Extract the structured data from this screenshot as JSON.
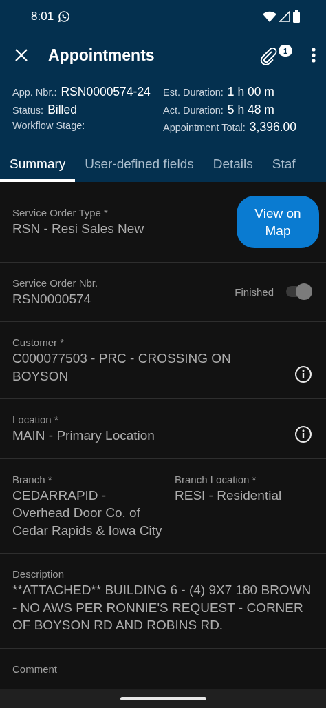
{
  "status_bar": {
    "time": "8:01"
  },
  "app_bar": {
    "title": "Appointments",
    "attachment_count": "1"
  },
  "summary": {
    "left": [
      {
        "label": "App. Nbr.:",
        "value": "RSN0000574-24"
      },
      {
        "label": "Status:",
        "value": "Billed"
      },
      {
        "label": "Workflow Stage:"
      }
    ],
    "right": [
      {
        "label": "Est. Duration:",
        "value": "1 h 00 m"
      },
      {
        "label": "Act. Duration:",
        "value": "5 h 48 m"
      },
      {
        "label": "Appointment Total:",
        "value": "3,396.00"
      }
    ]
  },
  "tabs": [
    {
      "label": "Summary",
      "selected": true
    },
    {
      "label": "User-defined fields",
      "selected": false
    },
    {
      "label": "Details",
      "selected": false
    },
    {
      "label": "Staf",
      "selected": false
    }
  ],
  "form": [
    {
      "kind": "button",
      "fields": [
        {
          "label": "Service Order Type *",
          "value": "RSN - Resi Sales New"
        }
      ],
      "button": "View on Map"
    },
    {
      "kind": "toggle",
      "fields": [
        {
          "label": "Service Order Nbr.",
          "value": "RSN0000574"
        }
      ],
      "toggle": {
        "label": "Finished",
        "checked": true,
        "disabled": true
      }
    },
    {
      "kind": "info",
      "fields": [
        {
          "label": "Customer *",
          "value": "C000077503 - PRC - CROSSING ON BOYSON"
        }
      ]
    },
    {
      "kind": "info",
      "fields": [
        {
          "label": "Location *",
          "value": "MAIN - Primary Location"
        }
      ]
    },
    {
      "kind": "plain",
      "fields": [
        {
          "label": "Branch *",
          "value": "CEDARRAPID - Overhead Door Co. of Cedar Rapids & Iowa City"
        },
        {
          "label": "Branch Location *",
          "value": "RESI - Residential"
        }
      ]
    },
    {
      "kind": "plain",
      "fields": [
        {
          "label": "Description",
          "value": "**ATTACHED** BUILDING 6 - (4) 9X7 180 BROWN  - NO AWS PER RONNIE'S REQUEST - CORNER OF BOYSON RD AND ROBINS RD."
        }
      ]
    },
    {
      "kind": "plain",
      "fields": [
        {
          "label": "Comment"
        }
      ]
    }
  ]
}
